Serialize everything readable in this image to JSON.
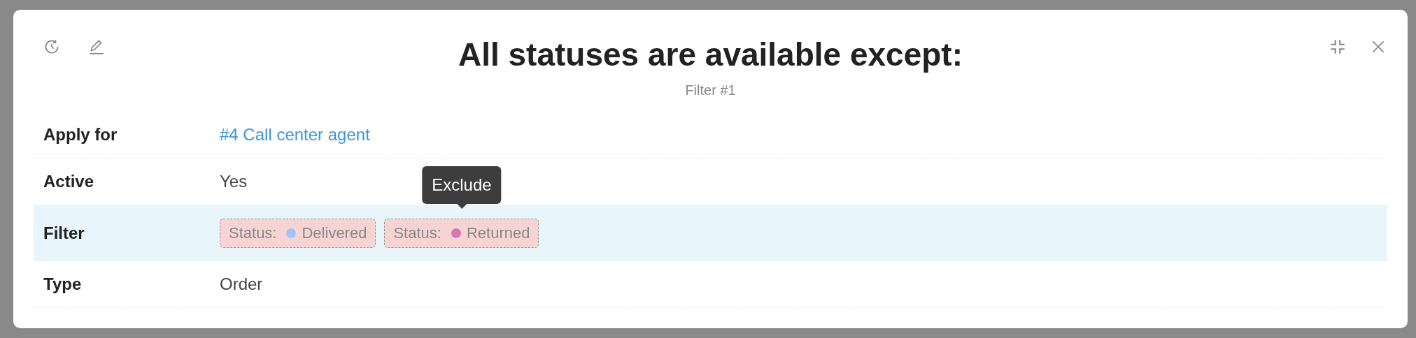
{
  "dialog": {
    "title": "All statuses are available except:",
    "subtitle": "Filter #1"
  },
  "rows": [
    {
      "label": "Apply for",
      "kind": "link",
      "value": "#4 Call center agent",
      "highlighted": false
    },
    {
      "label": "Active",
      "kind": "text",
      "value": "Yes",
      "highlighted": false
    },
    {
      "label": "Filter",
      "kind": "chips",
      "highlighted": true,
      "chips": [
        {
          "prefix": "Status:",
          "value": "Delivered",
          "color": "#a3c4f7"
        },
        {
          "prefix": "Status:",
          "value": "Returned",
          "color": "#d977b5",
          "tooltip": "Exclude"
        }
      ]
    },
    {
      "label": "Type",
      "kind": "text",
      "value": "Order",
      "highlighted": false
    }
  ]
}
